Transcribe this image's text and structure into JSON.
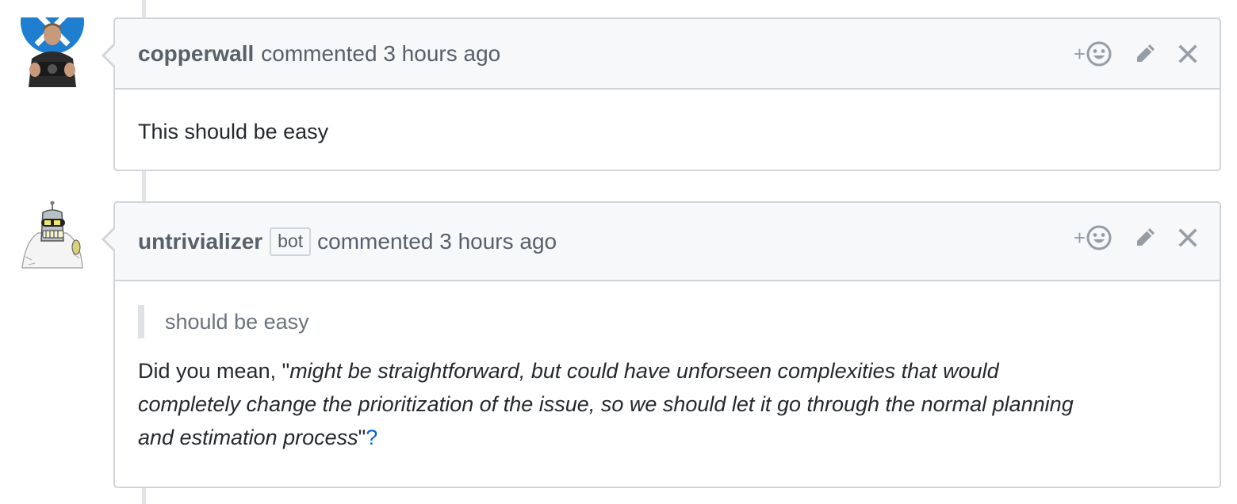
{
  "comments": [
    {
      "author": "copperwall",
      "action_text": "commented 3 hours ago",
      "body": "This should be easy"
    },
    {
      "author": "untrivializer",
      "badge": "bot",
      "action_text": "commented 3 hours ago",
      "quote": "should be easy",
      "body_prefix": "Did you mean, \"",
      "body_italic_1": "might be straightforward, but could have unforseen complexities that would",
      "body_italic_2": "completely change the prioritization of the issue, so we should let it go through the normal planning",
      "body_italic_3": "and estimation process",
      "body_suffix": "\"",
      "link_text": "?"
    }
  ],
  "icons": {
    "add_reaction_plus": "+",
    "reaction": "smiley-icon",
    "edit": "pencil-icon",
    "delete": "close-icon"
  },
  "colors": {
    "header_bg": "#f6f8fa",
    "border": "#d1d5da",
    "link": "#0366d6",
    "muted": "#586069"
  }
}
